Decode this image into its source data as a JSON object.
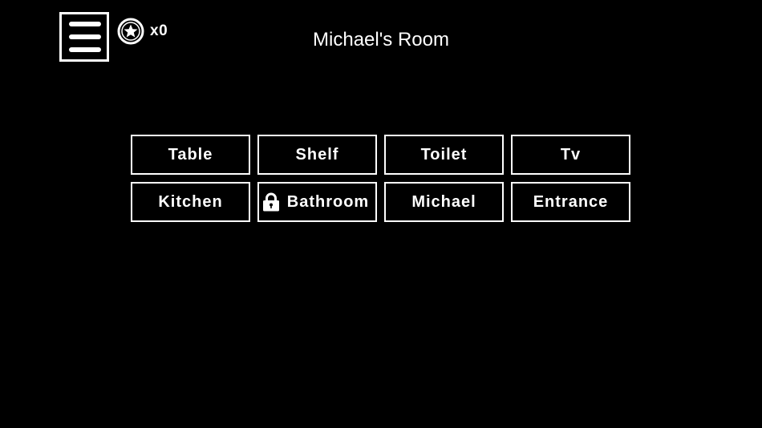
{
  "header": {
    "room_title": "Michael's Room",
    "coin_count": "x0",
    "menu_icon": "hamburger-menu-icon",
    "coin_icon": "star-coin-icon"
  },
  "locations": [
    {
      "label": "Table",
      "locked": false
    },
    {
      "label": "Shelf",
      "locked": false
    },
    {
      "label": "Toilet",
      "locked": false
    },
    {
      "label": "Tv",
      "locked": false
    },
    {
      "label": "Kitchen",
      "locked": false
    },
    {
      "label": "Bathroom",
      "locked": true,
      "icon": "lock-icon"
    },
    {
      "label": "Michael",
      "locked": false
    },
    {
      "label": "Entrance",
      "locked": false
    }
  ],
  "colors": {
    "background": "#000000",
    "foreground": "#ffffff"
  }
}
